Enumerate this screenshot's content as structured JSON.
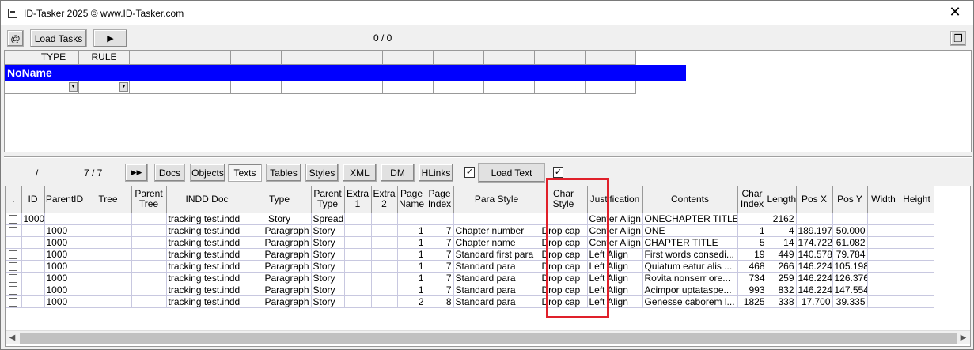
{
  "window": {
    "title": "ID-Tasker 2025  © www.ID-Tasker.com",
    "close": "✕"
  },
  "toolbar": {
    "at_label": "@",
    "load_tasks_label": "Load Tasks",
    "play_label": "▶",
    "counter": "0 / 0",
    "restore_label": "❐"
  },
  "tasks_grid": {
    "columns": [
      "",
      "TYPE",
      "RULE",
      "",
      "",
      "",
      "",
      "",
      "",
      "",
      "",
      "",
      ""
    ],
    "group_name": "NoName"
  },
  "lower_toolbar": {
    "slash": "/",
    "count": "7 / 7",
    "ff_label": "▶▶",
    "tabs": [
      "Docs",
      "Objects",
      "Texts",
      "Tables",
      "Styles",
      "XML",
      "DM",
      "HLinks"
    ],
    "active_tab": "Texts",
    "checkbox1_mark": "✓",
    "load_text_label": "Load Text",
    "checkbox2_mark": "✓"
  },
  "texts_table": {
    "headers": [
      ".",
      "ID",
      "ParentID",
      "Tree",
      "Parent\nTree",
      "INDD Doc",
      "Type",
      "Parent\nType",
      "Extra\n1",
      "Extra\n2",
      "Page\nName",
      "Page\nIndex",
      "Para Style",
      "Char\nStyle",
      "Justification",
      "Contents",
      "Char\nIndex",
      "Length",
      "Pos X",
      "Pos Y",
      "Width",
      "Height"
    ],
    "rows": [
      [
        "",
        "1000",
        "",
        "",
        "",
        "tracking test.indd",
        "Story",
        "Spread",
        "",
        "",
        "",
        "",
        "",
        "",
        "Center Align",
        "ONECHAPTER TITLE...",
        "",
        "2162",
        "",
        "",
        "",
        ""
      ],
      [
        "",
        "",
        "1000",
        "",
        "",
        "tracking test.indd",
        "Paragraph",
        "Story",
        "",
        "",
        "1",
        "7",
        "Chapter number",
        "Drop cap",
        "Center Align",
        "ONE",
        "1",
        "4",
        "189.197",
        "50.000",
        "",
        ""
      ],
      [
        "",
        "",
        "1000",
        "",
        "",
        "tracking test.indd",
        "Paragraph",
        "Story",
        "",
        "",
        "1",
        "7",
        "Chapter name",
        "Drop cap",
        "Center Align",
        "CHAPTER TITLE",
        "5",
        "14",
        "174.722",
        "61.082",
        "",
        ""
      ],
      [
        "",
        "",
        "1000",
        "",
        "",
        "tracking test.indd",
        "Paragraph",
        "Story",
        "",
        "",
        "1",
        "7",
        "Standard first para",
        "Drop cap",
        "Left Align",
        "First words consedi...",
        "19",
        "449",
        "140.578",
        "79.784",
        "",
        ""
      ],
      [
        "",
        "",
        "1000",
        "",
        "",
        "tracking test.indd",
        "Paragraph",
        "Story",
        "",
        "",
        "1",
        "7",
        "Standard para",
        "Drop cap",
        "Left Align",
        "Quiatum eatur alis ...",
        "468",
        "266",
        "146.224",
        "105.198",
        "",
        ""
      ],
      [
        "",
        "",
        "1000",
        "",
        "",
        "tracking test.indd",
        "Paragraph",
        "Story",
        "",
        "",
        "1",
        "7",
        "Standard para",
        "Drop cap",
        "Left Align",
        "Rovita nonserr ore...",
        "734",
        "259",
        "146.224",
        "126.376",
        "",
        ""
      ],
      [
        "",
        "",
        "1000",
        "",
        "",
        "tracking test.indd",
        "Paragraph",
        "Story",
        "",
        "",
        "1",
        "7",
        "Standard para",
        "Drop cap",
        "Left Align",
        "Acimpor uptataspe...",
        "993",
        "832",
        "146.224",
        "147.554",
        "",
        ""
      ],
      [
        "",
        "",
        "1000",
        "",
        "",
        "tracking test.indd",
        "Paragraph",
        "Story",
        "",
        "",
        "2",
        "8",
        "Standard para",
        "Drop cap",
        "Left Align",
        "Genesse caborem l...",
        "1825",
        "338",
        "17.700",
        "39.335",
        "",
        ""
      ]
    ]
  },
  "scrollbar": {
    "left": "◀",
    "right": "▶"
  },
  "colors": {
    "group_bg": "#0000ff",
    "highlight": "#e0202a"
  }
}
